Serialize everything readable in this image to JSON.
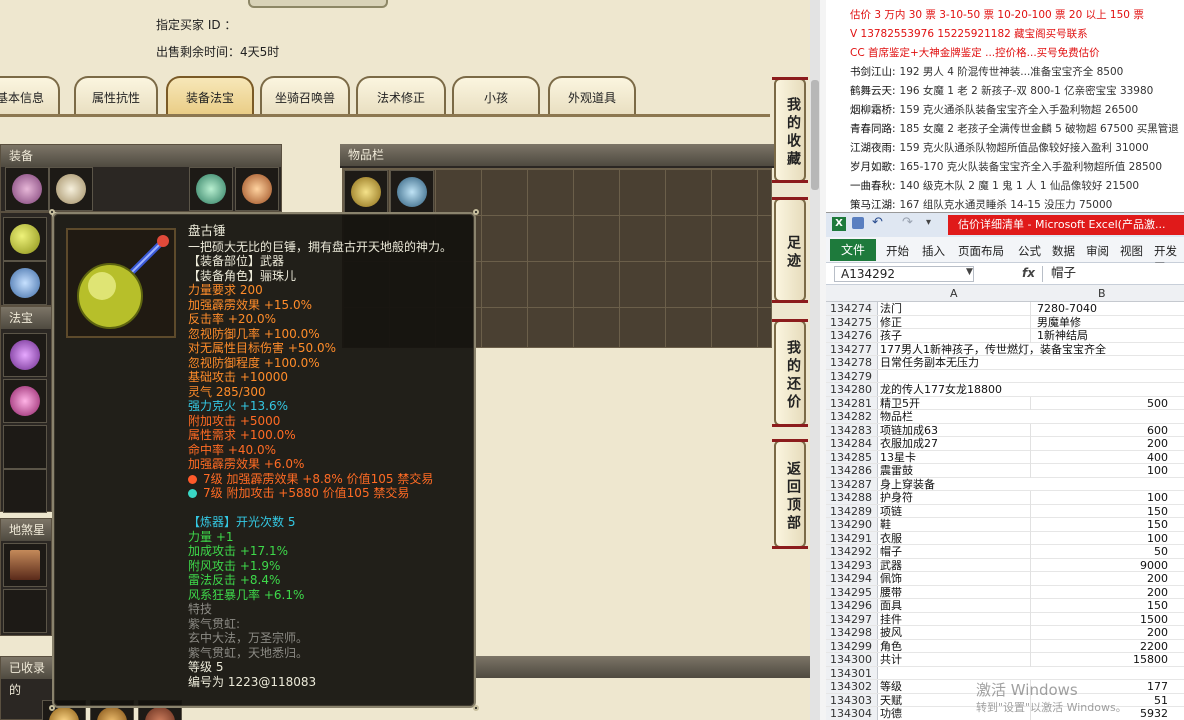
{
  "game": {
    "buyer_id_label": "指定买家 ID ：",
    "remaining_time_label": "出售剩余时间：",
    "remaining_time_value": "4天5时",
    "tabs": [
      "基本信息",
      "属性抗性",
      "装备法宝",
      "坐骑召唤兽",
      "法术修正",
      "小孩",
      "外观道具"
    ],
    "active_tab": "装备法宝",
    "panels": {
      "equipment": "装备",
      "inventory": "物品栏",
      "magic": "法宝",
      "beast": "地煞星局",
      "collected": "已收录的"
    },
    "side_buttons": [
      "我的收藏",
      "足迹",
      "我的还价",
      "返回顶部"
    ]
  },
  "tooltip": {
    "name": "盘古锤",
    "lines": [
      {
        "t": "一把硕大无比的巨锤，拥有盘古开天地般的神力。",
        "c": "w"
      },
      {
        "t": "【装备部位】武器",
        "c": "w"
      },
      {
        "t": "【装备角色】骊珠儿",
        "c": "w"
      },
      {
        "t": "力量要求 200",
        "c": "o"
      },
      {
        "t": "加强霹雳效果 +15.0%",
        "c": "o"
      },
      {
        "t": "反击率 +20.0%",
        "c": "o"
      },
      {
        "t": "忽视防御几率 +100.0%",
        "c": "o"
      },
      {
        "t": "对无属性目标伤害 +50.0%",
        "c": "o"
      },
      {
        "t": "忽视防御程度 +100.0%",
        "c": "o"
      },
      {
        "t": "基础攻击 +10000",
        "c": "o"
      },
      {
        "t": "灵气 285/300",
        "c": "o"
      },
      {
        "t": "强力克火 +13.6%",
        "c": "c"
      },
      {
        "t": "附加攻击 +5000",
        "c": "r"
      },
      {
        "t": "属性需求 +100.0%",
        "c": "r"
      },
      {
        "t": "命中率 +40.0%",
        "c": "r"
      },
      {
        "t": "加强霹雳效果 +6.0%",
        "c": "r"
      },
      {
        "t": "7级 加强霹雳效果 +8.8% 价值105 禁交易",
        "c": "r",
        "gem": "#ff5a2a"
      },
      {
        "t": "7级 附加攻击 +5880 价值105 禁交易",
        "c": "r",
        "gem": "#3ad7c5"
      },
      {
        "t": "",
        "c": "w"
      },
      {
        "t": "【炼器】开光次数 5",
        "c": "c"
      },
      {
        "t": "力量 +1",
        "c": "g"
      },
      {
        "t": "加成攻击 +17.1%",
        "c": "g"
      },
      {
        "t": "附风攻击 +1.9%",
        "c": "g"
      },
      {
        "t": "雷法反击 +8.4%",
        "c": "g"
      },
      {
        "t": "风系狂暴几率 +6.1%",
        "c": "g"
      },
      {
        "t": "特技",
        "c": "gr"
      },
      {
        "t": "紫气贯虹:",
        "c": "gr"
      },
      {
        "t": "玄中大法，万圣宗师。",
        "c": "gr"
      },
      {
        "t": "紫气贯虹，天地悉归。",
        "c": "gr"
      },
      {
        "t": "等级 5",
        "c": "w"
      },
      {
        "t": "编号为 1223@118083",
        "c": "w"
      }
    ]
  },
  "doc": {
    "lines": [
      {
        "a": "估价 3 万内 30 票   3-10-50 票   10-20-100 票   20 以上 150 票",
        "cls": "red"
      },
      {
        "a": "V 13782553976     15225921182   藏宝阁买号联系",
        "cls": "red"
      },
      {
        "a": "CC 首席鉴定+大神金牌鉴定  ...控价格...买号免费估价",
        "cls": "red"
      },
      {
        "a": "书剑江山:",
        "b": "192 男人 4 阶混传世神装...准备宝宝齐全 8500",
        "cls": "nm"
      },
      {
        "a": "鹤舞云天:",
        "b": "196 女魔 1 老 2 新孩子-双 800-1 亿亲密宝宝 33980",
        "cls": "nm"
      },
      {
        "a": "烟柳霜桥:",
        "b": "159 克火通杀队装备宝宝齐全入手盈利物超 26500",
        "cls": "nm"
      },
      {
        "a": "青春同路:",
        "b": "185 女魔 2 老孩子全满传世金麟 5 破物超 67500 买黑管退",
        "cls": "nm"
      },
      {
        "a": "江湖夜雨:",
        "b": "159 克火队通杀队物超所值品像较好接入盈利 31000",
        "cls": "nm"
      },
      {
        "a": "岁月如歌:",
        "b": "165-170 克火队装备宝宝齐全入手盈利物超所值 28500",
        "cls": "nm"
      },
      {
        "a": "一曲春秋:",
        "b": "140 级克木队 2 魔 1 鬼 1 人 1 仙品像较好 21500",
        "cls": "nm"
      },
      {
        "a": "策马江湖:",
        "b": "167 组队克水通灵睡杀 14-15 没压力 75000",
        "cls": "nm"
      }
    ]
  },
  "excel": {
    "title": "估价详细清单 - Microsoft Excel(产品激...",
    "file_tab": "文件",
    "ribbon_tabs": [
      "开始",
      "插入",
      "页面布局",
      "公式",
      "数据",
      "审阅",
      "视图",
      "开发工"
    ],
    "name_box": "A134292",
    "fx": "fx",
    "formula": "帽子",
    "col_a": "A",
    "col_b": "B",
    "rows": [
      {
        "n": "134274",
        "a": "法门",
        "b": "7280-7040",
        "bl": true
      },
      {
        "n": "134275",
        "a": "修正",
        "b": "男魔单修",
        "bl": true
      },
      {
        "n": "134276",
        "a": "孩子",
        "b": "1新神结局",
        "bl": true
      },
      {
        "n": "134277",
        "a": "177男人1新神孩子，传世燃灯，装备宝宝齐全",
        "b": ""
      },
      {
        "n": "134278",
        "a": "日常任务副本无压力",
        "b": ""
      },
      {
        "n": "134279",
        "a": "",
        "b": ""
      },
      {
        "n": "134280",
        "a": "龙的传人177女龙18800",
        "b": ""
      },
      {
        "n": "134281",
        "a": "精卫5开",
        "b": "500"
      },
      {
        "n": "134282",
        "a": "物品栏",
        "b": ""
      },
      {
        "n": "134283",
        "a": "项链加成63",
        "b": "600"
      },
      {
        "n": "134284",
        "a": "衣服加成27",
        "b": "200"
      },
      {
        "n": "134285",
        "a": "13星卡",
        "b": "400"
      },
      {
        "n": "134286",
        "a": "震雷鼓",
        "b": "100"
      },
      {
        "n": "134287",
        "a": "身上穿装备",
        "b": ""
      },
      {
        "n": "134288",
        "a": "护身符",
        "b": "100"
      },
      {
        "n": "134289",
        "a": "项链",
        "b": "150"
      },
      {
        "n": "134290",
        "a": "鞋",
        "b": "150"
      },
      {
        "n": "134291",
        "a": "衣服",
        "b": "100"
      },
      {
        "n": "134292",
        "a": "帽子",
        "b": "50"
      },
      {
        "n": "134293",
        "a": "武器",
        "b": "9000"
      },
      {
        "n": "134294",
        "a": "佩饰",
        "b": "200"
      },
      {
        "n": "134295",
        "a": "腰带",
        "b": "200"
      },
      {
        "n": "134296",
        "a": "面具",
        "b": "150"
      },
      {
        "n": "134297",
        "a": "挂件",
        "b": "1500"
      },
      {
        "n": "134298",
        "a": "披风",
        "b": "200"
      },
      {
        "n": "134299",
        "a": "角色",
        "b": "2200"
      },
      {
        "n": "134300",
        "a": "共计",
        "b": "15800"
      },
      {
        "n": "134301",
        "a": "",
        "b": ""
      },
      {
        "n": "134302",
        "a": "等级",
        "b": "177"
      },
      {
        "n": "134303",
        "a": "天赋",
        "b": "51"
      },
      {
        "n": "134304",
        "a": "功德",
        "b": "5932"
      }
    ],
    "watermark_line1": "激活 Windows",
    "watermark_line2": "转到\"设置\"以激活 Windows。"
  },
  "colors": {
    "tooltip_orange": "#ff8c2a",
    "tooltip_cyan": "#34c7e2",
    "tooltip_green": "#3ed94a",
    "excel_green": "#1e7a3c",
    "title_red": "#e01a1a"
  }
}
